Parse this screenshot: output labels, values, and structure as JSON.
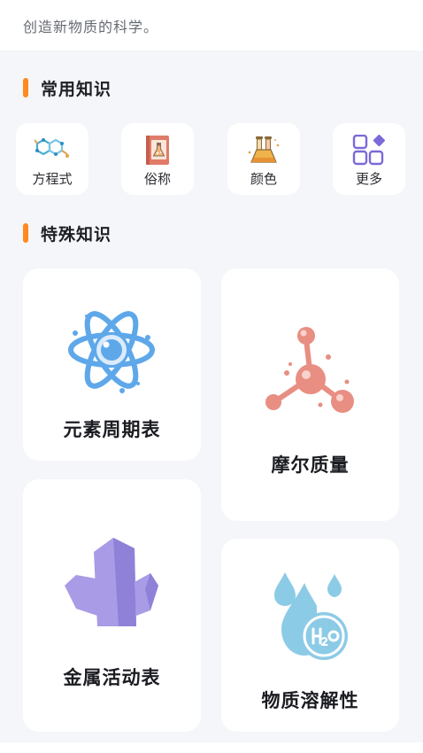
{
  "header": {
    "subtitle": "创造新物质的科学。"
  },
  "sections": {
    "common": {
      "title": "常用知识",
      "items": [
        {
          "label": "方程式",
          "icon": "molecule-hexagon-icon"
        },
        {
          "label": "俗称",
          "icon": "book-flask-icon"
        },
        {
          "label": "颜色",
          "icon": "test-tubes-icon"
        },
        {
          "label": "更多",
          "icon": "grid-more-icon"
        }
      ]
    },
    "special": {
      "title": "特殊知识",
      "cards": [
        {
          "label": "元素周期表",
          "icon": "atom-icon"
        },
        {
          "label": "摩尔质量",
          "icon": "molecule-icon"
        },
        {
          "label": "金属活动表",
          "icon": "crystal-icon"
        },
        {
          "label": "物质溶解性",
          "icon": "water-drops-h2o-icon"
        }
      ]
    }
  },
  "colors": {
    "accent": "#ff8a1f",
    "background": "#f5f6f9",
    "atom": "#5ea8ea",
    "molecule": "#e88e82",
    "crystal": "#a99be6",
    "water": "#8ccbe6",
    "more_icon": "#7b6ad8"
  }
}
